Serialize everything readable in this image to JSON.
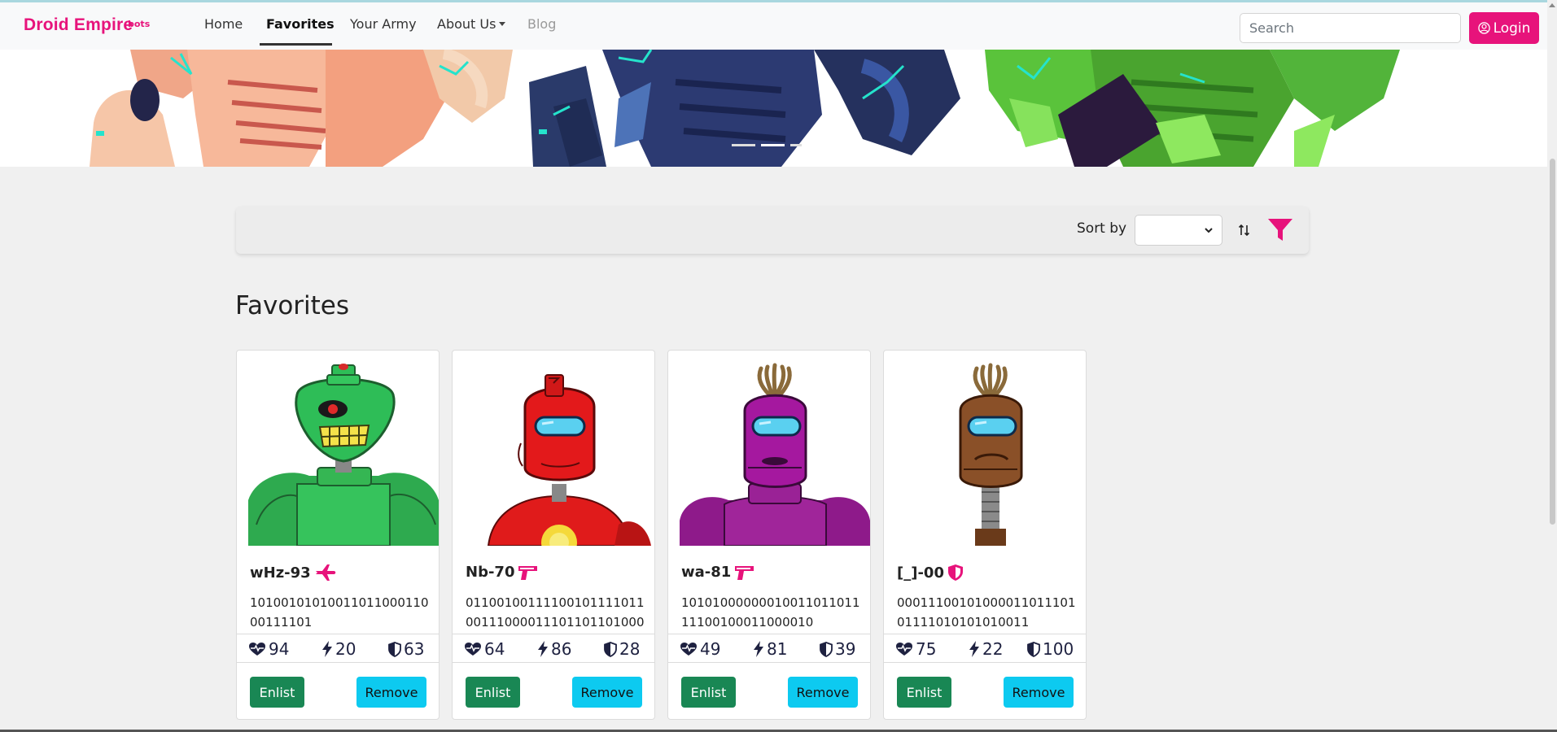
{
  "navbar": {
    "brand": "Droid Empire",
    "brand_suffix": "bots",
    "links": [
      "Home",
      "Favorites",
      "Your Army",
      "About Us",
      "Blog"
    ],
    "search_placeholder": "Search",
    "login_label": "Login"
  },
  "sortbar": {
    "sort_label": "Sort by",
    "selected": ""
  },
  "section_title": "Favorites",
  "colors": {
    "brand": "#e7137b",
    "enlist": "#198754",
    "remove": "#0dcaf0"
  },
  "cards": [
    {
      "name": "wHz-93",
      "class_icon": "plane-icon",
      "binary": "1010010101001101100011000111101",
      "health": "94",
      "damage": "20",
      "armor": "63",
      "enlist_label": "Enlist",
      "remove_label": "Remove"
    },
    {
      "name": "Nb-70",
      "class_icon": "pistol-icon",
      "binary": "0110010011110010111101100111000011101101101000",
      "health": "64",
      "damage": "86",
      "armor": "28",
      "enlist_label": "Enlist",
      "remove_label": "Remove"
    },
    {
      "name": "wa-81",
      "class_icon": "pistol-icon",
      "binary": "1010100000001001101101111100100011000010",
      "health": "49",
      "damage": "81",
      "armor": "39",
      "enlist_label": "Enlist",
      "remove_label": "Remove"
    },
    {
      "name": "[_]-00",
      "class_icon": "shield-icon",
      "binary": "0001110010100001101110101111010101010011",
      "health": "75",
      "damage": "22",
      "armor": "100",
      "enlist_label": "Enlist",
      "remove_label": "Remove"
    }
  ]
}
